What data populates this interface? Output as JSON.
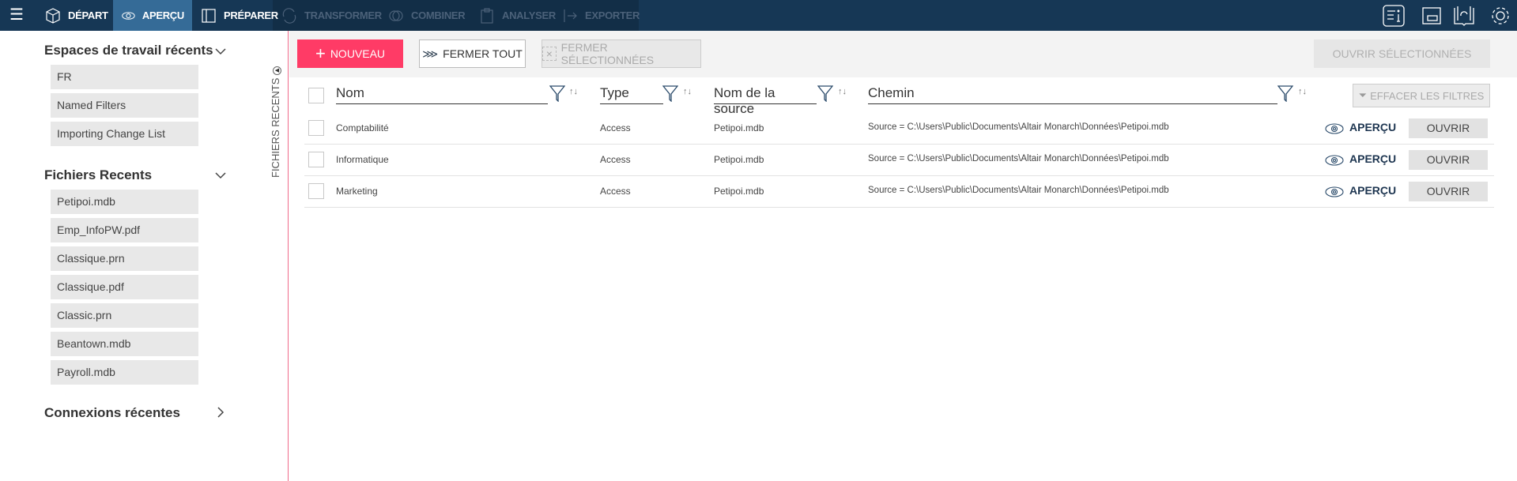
{
  "nav": {
    "tabs": [
      {
        "label": "DÉPART",
        "icon": "cube-icon"
      },
      {
        "label": "APERÇU",
        "icon": "eye-icon"
      },
      {
        "label": "PRÉPARER",
        "icon": "prepare-icon"
      },
      {
        "label": "TRANSFORMER",
        "icon": "transform-icon"
      },
      {
        "label": "COMBINER",
        "icon": "combine-icon"
      },
      {
        "label": "ANALYSER",
        "icon": "clipboard-icon"
      },
      {
        "label": "EXPORTER",
        "icon": "export-icon"
      }
    ]
  },
  "sidebar": {
    "vertical_label": "FICHIERS RECENTS",
    "workspaces": {
      "title": "Espaces de travail récents",
      "items": [
        "FR",
        "Named Filters",
        "Importing Change List"
      ]
    },
    "files": {
      "title": "Fichiers Recents",
      "items": [
        "Petipoi.mdb",
        "Emp_InfoPW.pdf",
        "Classique.prn",
        "Classique.pdf",
        "Classic.prn",
        "Beantown.mdb",
        "Payroll.mdb"
      ]
    },
    "connections": {
      "title": "Connexions récentes"
    }
  },
  "toolbar": {
    "new": "NOUVEAU",
    "close_all": "FERMER TOUT",
    "close_selected": "FERMER SÉLECTIONNÉES",
    "open_selected": "OUVRIR SÉLECTIONNÉES"
  },
  "table": {
    "headers": {
      "name": "Nom",
      "type": "Type",
      "source": "Nom de la source",
      "path": "Chemin"
    },
    "clear_filters": "EFFACER LES FILTRES",
    "rows": [
      {
        "name": "Comptabilité",
        "type": "Access",
        "source": "Petipoi.mdb",
        "path": "Source = C:\\Users\\Public\\Documents\\Altair Monarch\\Données\\Petipoi.mdb",
        "preview": "APERÇU",
        "open": "OUVRIR"
      },
      {
        "name": "Informatique",
        "type": "Access",
        "source": "Petipoi.mdb",
        "path": "Source = C:\\Users\\Public\\Documents\\Altair Monarch\\Données\\Petipoi.mdb",
        "preview": "APERÇU",
        "open": "OUVRIR"
      },
      {
        "name": "Marketing",
        "type": "Access",
        "source": "Petipoi.mdb",
        "path": "Source = C:\\Users\\Public\\Documents\\Altair Monarch\\Données\\Petipoi.mdb",
        "preview": "APERÇU",
        "open": "OUVRIR"
      }
    ]
  }
}
